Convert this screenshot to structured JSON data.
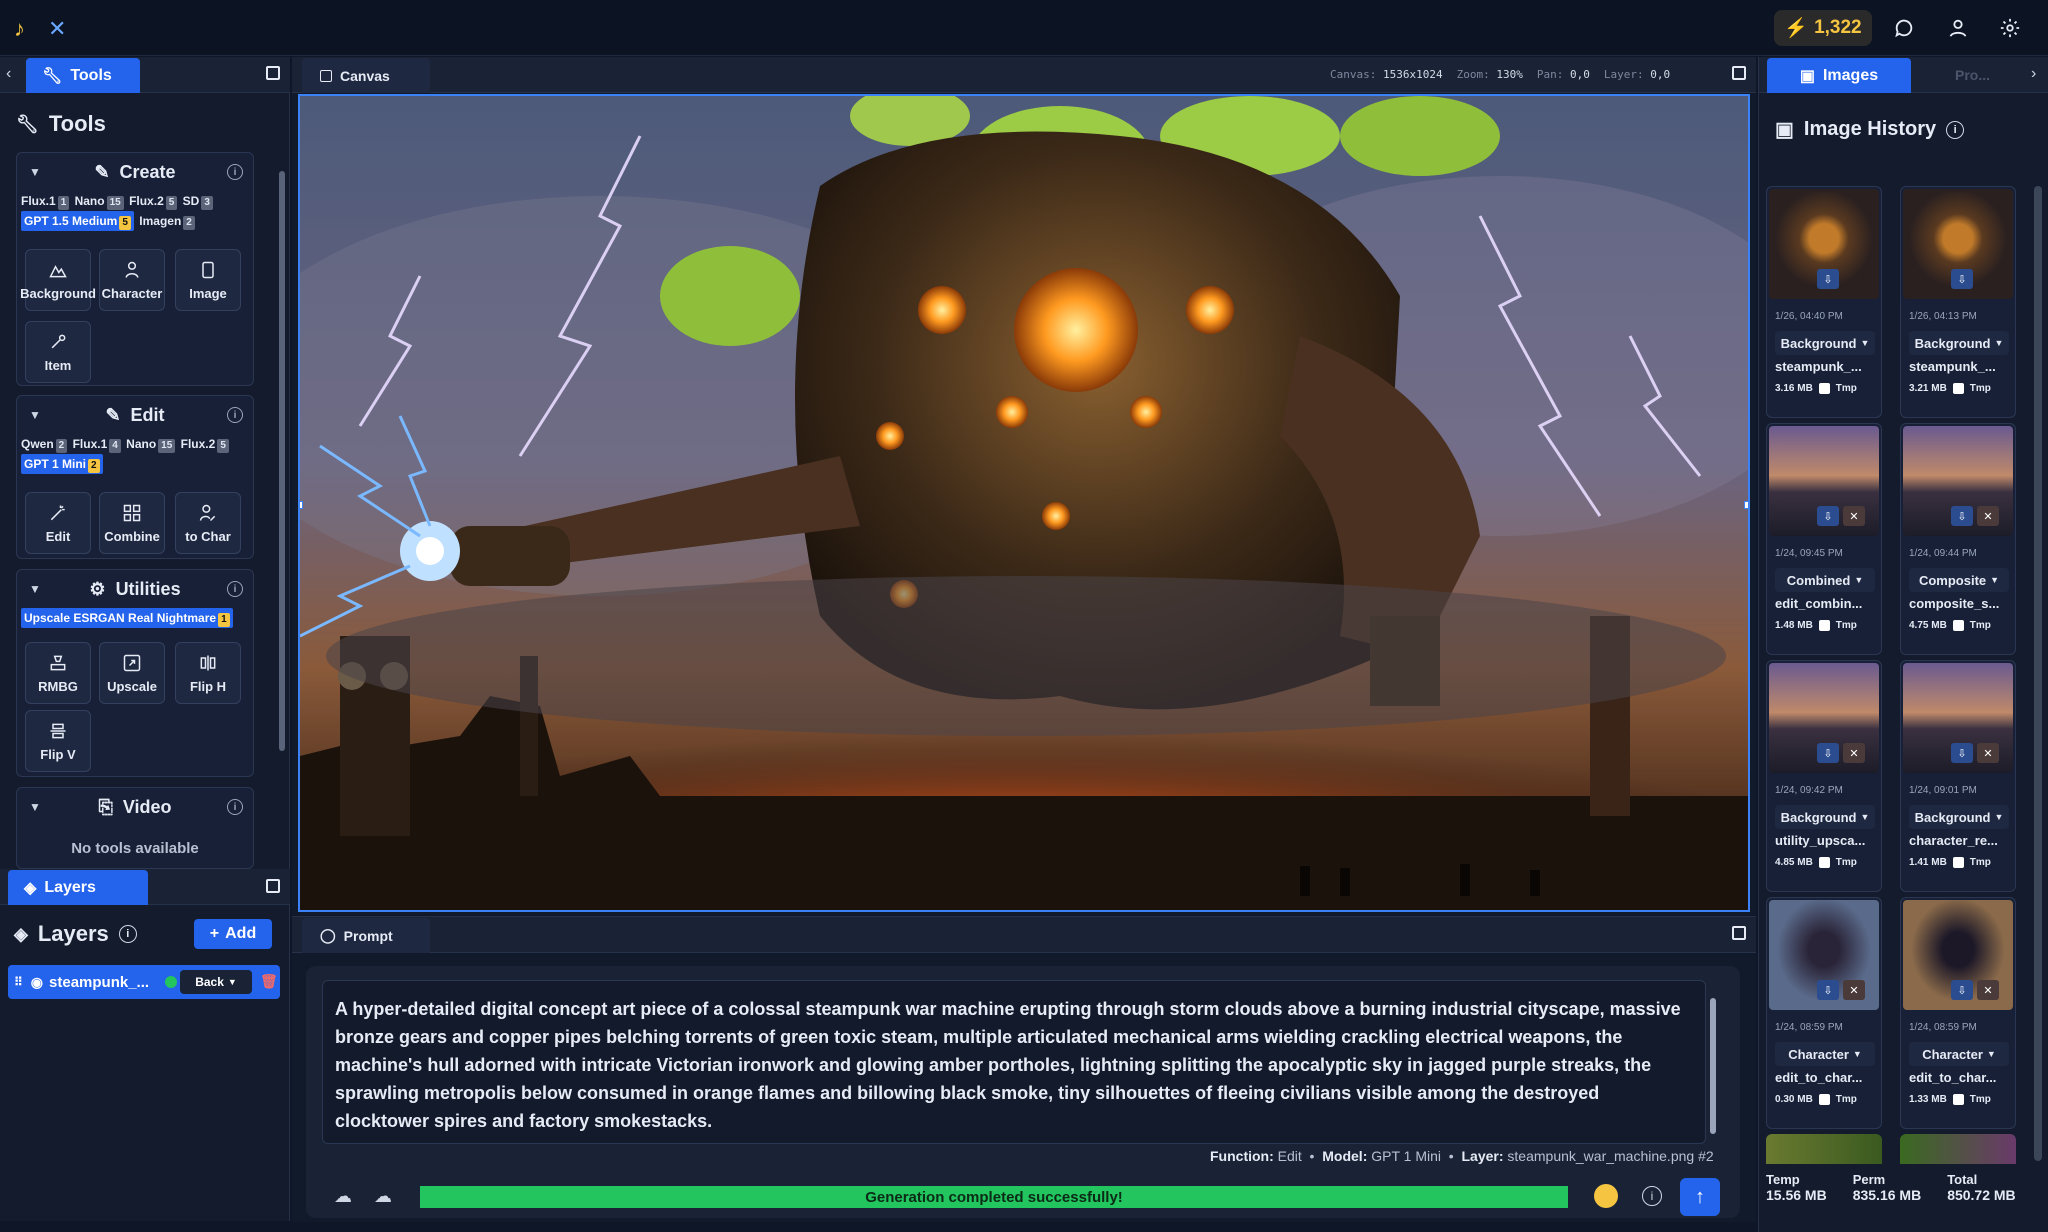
{
  "topbar": {
    "credits": "1,322"
  },
  "tools_panel": {
    "tab_label": "Tools",
    "title": "Tools",
    "create": {
      "label": "Create",
      "chips_row1": [
        {
          "name": "Flux.1",
          "n": "1"
        },
        {
          "name": "Nano",
          "n": "15"
        },
        {
          "name": "Flux.2",
          "n": "5"
        },
        {
          "name": "SD",
          "n": "3"
        }
      ],
      "chips_row2": [
        {
          "name": "GPT 1.5 Medium",
          "n": "5",
          "selected": true
        },
        {
          "name": "Imagen",
          "n": "2"
        }
      ],
      "buttons": [
        "Background",
        "Character",
        "Image",
        "Item"
      ]
    },
    "edit": {
      "label": "Edit",
      "chips_row1": [
        {
          "name": "Qwen",
          "n": "2"
        },
        {
          "name": "Flux.1",
          "n": "4"
        },
        {
          "name": "Nano",
          "n": "15"
        },
        {
          "name": "Flux.2",
          "n": "5"
        }
      ],
      "chips_row2": [
        {
          "name": "GPT 1 Mini",
          "n": "2",
          "selected": true
        }
      ],
      "buttons": [
        "Edit",
        "Combine",
        "to Char"
      ]
    },
    "utilities": {
      "label": "Utilities",
      "chips_row1": [
        {
          "name": "Upscale ESRGAN Real Nightmare",
          "n": "1",
          "selected": true
        }
      ],
      "buttons": [
        "RMBG",
        "Upscale",
        "Flip H",
        "Flip V"
      ]
    },
    "video": {
      "label": "Video",
      "empty": "No tools available"
    }
  },
  "layers_panel": {
    "tab_label": "Layers",
    "title": "Layers",
    "add_label": "Add",
    "layers": [
      {
        "name": "steampunk_...",
        "position": "Back"
      }
    ]
  },
  "canvas": {
    "tab_label": "Canvas",
    "info": {
      "canvas_label": "Canvas:",
      "canvas": "1536x1024",
      "zoom_label": "Zoom:",
      "zoom": "130%",
      "pan_label": "Pan:",
      "pan": "0,0",
      "layer_label": "Layer:",
      "layer": "0,0"
    }
  },
  "prompt": {
    "tab_label": "Prompt",
    "text": "A hyper-detailed digital concept art piece of a colossal steampunk war machine erupting through storm clouds above a burning industrial cityscape, massive bronze gears and copper pipes belching torrents of green toxic steam, multiple articulated mechanical arms wielding crackling electrical weapons, the machine's hull adorned with intricate Victorian ironwork and glowing amber portholes, lightning splitting the apocalyptic sky in jagged purple streaks, the sprawling metropolis below consumed in orange flames and billowing black smoke, tiny silhouettes of fleeing civilians visible among the destroyed clocktower spires and factory smokestacks.",
    "function_label": "Function:",
    "function": "Edit",
    "model_label": "Model:",
    "model": "GPT 1 Mini",
    "layer_label": "Layer:",
    "layer": "steampunk_war_machine.png #2",
    "status": "Generation completed successfully!"
  },
  "images_panel": {
    "tab_label": "Images",
    "tab2_label": "Pro...",
    "title": "Image History",
    "cards": [
      {
        "date": "1/26, 04:40 PM",
        "type": "Background",
        "name": "steampunk_...",
        "size": "3.16 MB",
        "tmp": "Tmp",
        "theme": "machine"
      },
      {
        "date": "1/26, 04:13 PM",
        "type": "Background",
        "name": "steampunk_...",
        "size": "3.21 MB",
        "tmp": "Tmp",
        "theme": "machine"
      },
      {
        "date": "1/24, 09:45 PM",
        "type": "Combined",
        "name": "edit_combin...",
        "size": "1.48 MB",
        "tmp": "Tmp",
        "theme": "dusk"
      },
      {
        "date": "1/24, 09:44 PM",
        "type": "Composite",
        "name": "composite_s...",
        "size": "4.75 MB",
        "tmp": "Tmp",
        "theme": "dusk"
      },
      {
        "date": "1/24, 09:42 PM",
        "type": "Background",
        "name": "utility_upsca...",
        "size": "4.85 MB",
        "tmp": "Tmp",
        "theme": "dusk"
      },
      {
        "date": "1/24, 09:01 PM",
        "type": "Background",
        "name": "character_re...",
        "size": "1.41 MB",
        "tmp": "Tmp",
        "theme": "dusk"
      },
      {
        "date": "1/24, 08:59 PM",
        "type": "Character",
        "name": "edit_to_char...",
        "size": "0.30 MB",
        "tmp": "Tmp",
        "theme": "char"
      },
      {
        "date": "1/24, 08:59 PM",
        "type": "Character",
        "name": "edit_to_char...",
        "size": "1.33 MB",
        "tmp": "Tmp",
        "theme": "char2"
      }
    ],
    "stats": {
      "temp_label": "Temp",
      "temp": "15.56 MB",
      "perm_label": "Perm",
      "perm": "835.16 MB",
      "total_label": "Total",
      "total": "850.72 MB"
    }
  },
  "colors": {
    "accent": "#2463eb",
    "success": "#22c55e",
    "gold": "#f5c542",
    "panel": "#131b2d"
  }
}
